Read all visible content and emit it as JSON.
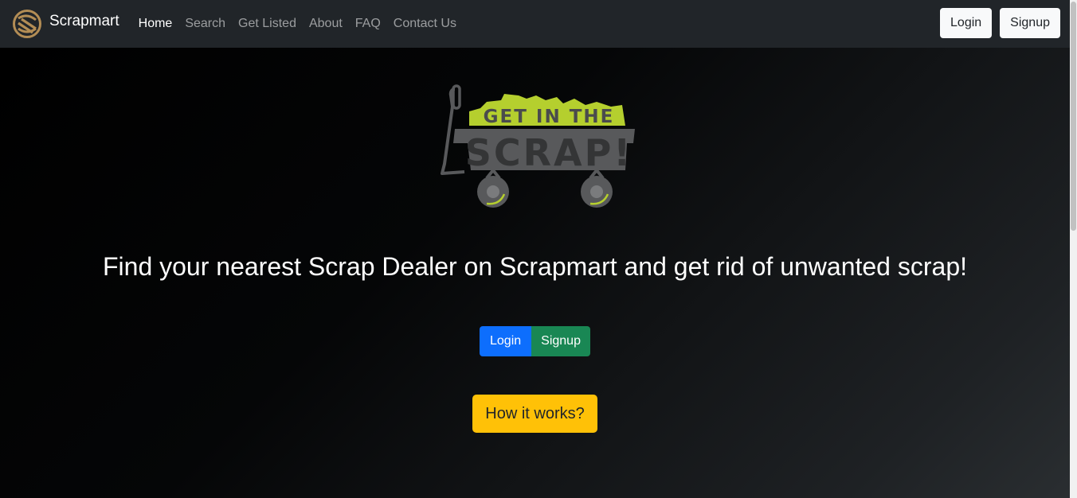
{
  "navbar": {
    "brand_name": "Scrapmart",
    "links": [
      {
        "label": "Home",
        "active": true
      },
      {
        "label": "Search",
        "active": false
      },
      {
        "label": "Get Listed",
        "active": false
      },
      {
        "label": "About",
        "active": false
      },
      {
        "label": "FAQ",
        "active": false
      },
      {
        "label": "Contact Us",
        "active": false
      }
    ],
    "login_label": "Login",
    "signup_label": "Signup"
  },
  "hero": {
    "logo_text_top": "GET IN THE",
    "logo_text_bottom": "SCRAP!",
    "tagline": "Find your nearest Scrap Dealer on Scrapmart and get rid of unwanted scrap!",
    "login_label": "Login",
    "signup_label": "Signup",
    "how_label": "How it works?"
  },
  "colors": {
    "navbar_bg": "#212529",
    "logo_green": "#b5cf2e",
    "logo_gray": "#58595b",
    "primary": "#0d6efd",
    "success": "#198754",
    "warning": "#ffc107"
  }
}
